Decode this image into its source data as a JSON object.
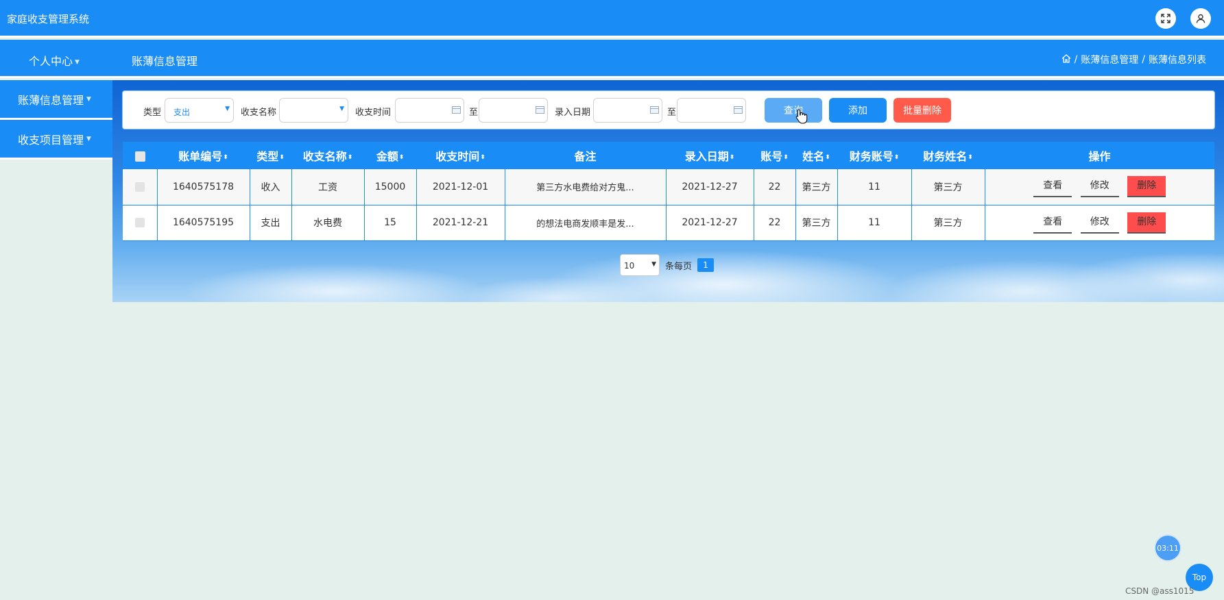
{
  "app": {
    "title": "家庭收支管理系统"
  },
  "header_icons": [
    "fullscreen-icon",
    "user-icon"
  ],
  "navbar": {
    "personal_center": "个人中心",
    "page_title": "账薄信息管理",
    "breadcrumb": [
      "账薄信息管理",
      "账薄信息列表"
    ],
    "breadcrumb_separator": "/"
  },
  "sidebar": {
    "items": [
      {
        "label": "账薄信息管理"
      },
      {
        "label": "收支项目管理"
      }
    ]
  },
  "search": {
    "type_label": "类型",
    "type_value": "支出",
    "name_label": "收支名称",
    "name_value": "",
    "time_label": "收支时间",
    "to_label": "至",
    "entry_label": "录入日期",
    "to_label2": "至",
    "query_button": "查询",
    "add_button": "添加",
    "batch_delete_button": "批量删除"
  },
  "table": {
    "columns": [
      "账单编号",
      "类型",
      "收支名称",
      "金额",
      "收支时间",
      "备注",
      "录入日期",
      "账号",
      "姓名",
      "财务账号",
      "财务姓名",
      "操作"
    ],
    "rows": [
      [
        "1640575178",
        "收入",
        "工资",
        "15000",
        "2021-12-01",
        "第三方水电费给对方鬼...",
        "2021-12-27",
        "22",
        "第三方",
        "11",
        "第三方"
      ],
      [
        "1640575195",
        "支出",
        "水电费",
        "15",
        "2021-12-21",
        "的想法电商发顺丰是发...",
        "2021-12-27",
        "22",
        "第三方",
        "11",
        "第三方"
      ]
    ],
    "actions": {
      "view": "查看",
      "edit": "修改",
      "delete": "删除"
    }
  },
  "pagination": {
    "page_size": "10",
    "per_page_label": "条每页",
    "current_page": "1"
  },
  "floating": {
    "timer": "03:11",
    "top": "Top"
  },
  "watermark": "CSDN @ass1015",
  "colors": {
    "primary": "#1a8cf5",
    "danger": "#ff4d4d",
    "page_bg": "#e4f0ec"
  }
}
